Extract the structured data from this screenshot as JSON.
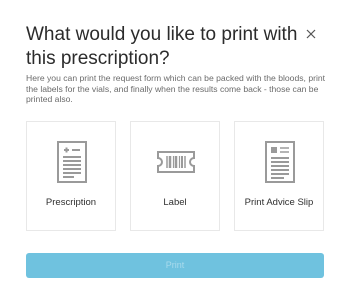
{
  "dialog": {
    "title": "What would you like to print with this prescription?",
    "description": "Here you can print the request form which can be packed with the bloods, print the labels for the vials, and finally when the results come back - those can be printed also.",
    "close_icon": "close-icon"
  },
  "options": [
    {
      "label": "Prescription",
      "icon": "prescription-document-icon"
    },
    {
      "label": "Label",
      "icon": "barcode-label-icon"
    },
    {
      "label": "Print Advice Slip",
      "icon": "advice-slip-document-icon"
    }
  ],
  "print_button": {
    "label": "Print",
    "state": "disabled"
  },
  "colors": {
    "accent": "#6fc2df",
    "icon_gray": "#9a9a9a",
    "card_border": "#e8e8e8"
  }
}
